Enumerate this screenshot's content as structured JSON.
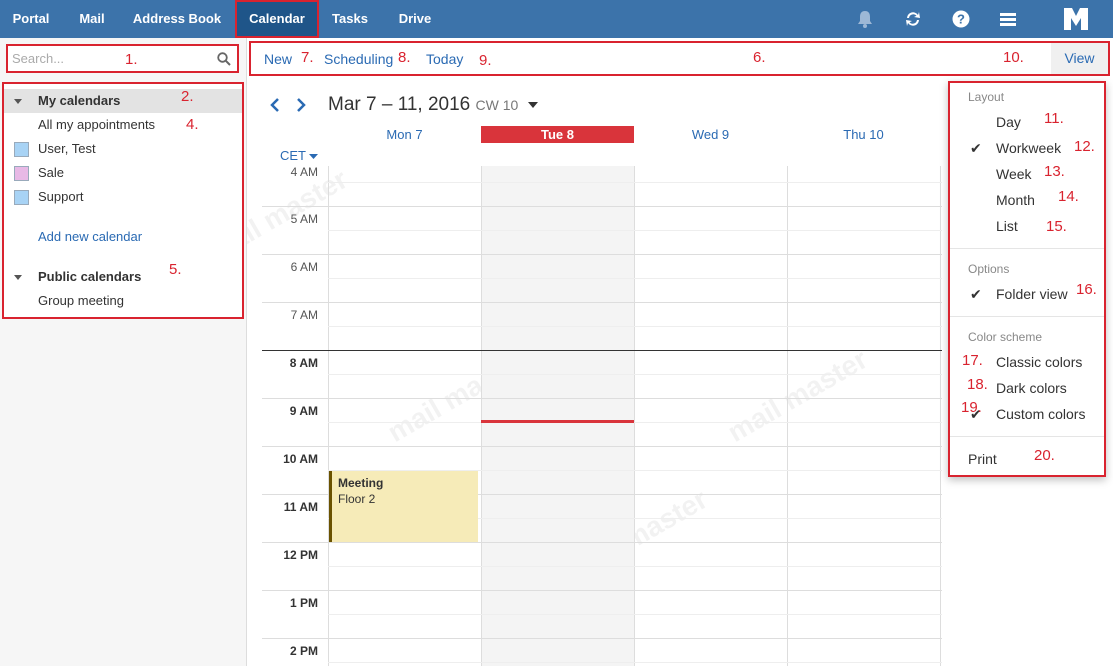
{
  "nav": {
    "items": [
      {
        "label": "Portal"
      },
      {
        "label": "Mail"
      },
      {
        "label": "Address Book"
      },
      {
        "label": "Calendar"
      },
      {
        "label": "Tasks"
      },
      {
        "label": "Drive"
      }
    ],
    "active": "Calendar",
    "icons": [
      "bell-icon",
      "refresh-icon",
      "help-icon",
      "menu-icon",
      "logo-icon"
    ]
  },
  "sidebar": {
    "search_placeholder": "Search...",
    "my_calendars_label": "My calendars",
    "items": [
      {
        "label": "All my appointments"
      },
      {
        "label": "User, Test",
        "color": "#a8d3f5"
      },
      {
        "label": "Sale",
        "color": "#e8b9e6"
      },
      {
        "label": "Support",
        "color": "#a8d3f5"
      }
    ],
    "add_label": "Add new calendar",
    "public_calendars_label": "Public calendars",
    "public_items": [
      {
        "label": "Group meeting"
      }
    ]
  },
  "toolbar": {
    "new_label": "New",
    "scheduling_label": "Scheduling",
    "today_label": "Today",
    "view_label": "View"
  },
  "calendar": {
    "date_range": "Mar 7 – 11, 2016",
    "cw": "CW 10",
    "days": [
      {
        "label": "Mon 7"
      },
      {
        "label": "Tue 8",
        "today": true
      },
      {
        "label": "Wed 9"
      },
      {
        "label": "Thu 10"
      }
    ],
    "timezone": "CET",
    "hours": [
      "4 AM",
      "5 AM",
      "6 AM",
      "7 AM",
      "8 AM",
      "9 AM",
      "10 AM",
      "11 AM",
      "12 PM",
      "1 PM",
      "2 PM"
    ],
    "event": {
      "title": "Meeting",
      "location": "Floor 2"
    }
  },
  "view_menu": {
    "layout_label": "Layout",
    "layout_items": [
      {
        "label": "Day",
        "checked": false
      },
      {
        "label": "Workweek",
        "checked": true
      },
      {
        "label": "Week",
        "checked": false
      },
      {
        "label": "Month",
        "checked": false
      },
      {
        "label": "List",
        "checked": false
      }
    ],
    "options_label": "Options",
    "folder_view_label": "Folder view",
    "color_scheme_label": "Color scheme",
    "color_items": [
      {
        "label": "Classic colors",
        "checked": false
      },
      {
        "label": "Dark colors",
        "checked": false
      },
      {
        "label": "Custom colors",
        "checked": true
      }
    ],
    "print_label": "Print"
  },
  "annotations": [
    "1.",
    "2.",
    "4.",
    "5.",
    "6.",
    "7.",
    "8.",
    "9.",
    "10.",
    "11.",
    "12.",
    "13.",
    "14.",
    "15.",
    "16.",
    "17.",
    "18.",
    "19.",
    "20."
  ],
  "watermark": "mail master",
  "colors": {
    "topbar": "#3c73aa",
    "accent": "#2a6ab3",
    "today": "#d9343b",
    "annotation": "#d9232f"
  }
}
